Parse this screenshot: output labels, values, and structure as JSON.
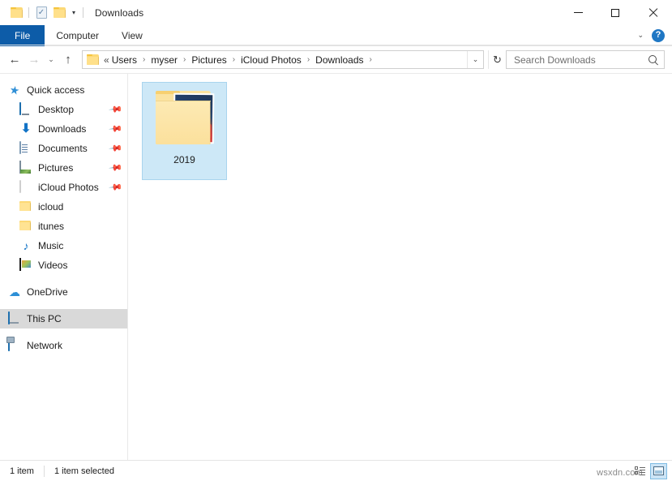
{
  "window": {
    "title": "Downloads",
    "quick_access_toolbar": [
      {
        "name": "folder-icon",
        "label": ""
      },
      {
        "name": "properties-icon",
        "label": ""
      },
      {
        "name": "new-folder-icon",
        "label": ""
      },
      {
        "name": "customize-caret",
        "label": "▾"
      }
    ],
    "controls": {
      "minimize": "Minimize",
      "maximize": "Maximize",
      "close": "Close"
    }
  },
  "ribbon": {
    "tabs": [
      {
        "label": "File",
        "active": true
      },
      {
        "label": "Computer",
        "active": false
      },
      {
        "label": "View",
        "active": false
      }
    ],
    "collapse_caret": "⌄",
    "help_label": "?"
  },
  "addressbar": {
    "back": "←",
    "forward": "→",
    "recent": "⌄",
    "up": "↑",
    "chevron_prefix": "«",
    "crumbs": [
      "Users",
      "myser",
      "Pictures",
      "iCloud Photos",
      "Downloads"
    ],
    "crumb_separator": "›",
    "dropdown_caret": "⌄",
    "refresh": "↻"
  },
  "search": {
    "placeholder": "Search Downloads",
    "value": ""
  },
  "sidebar": {
    "items": [
      {
        "label": "Quick access",
        "icon": "star-icon",
        "pinned": false,
        "root": true,
        "selected": false,
        "gap_before": false
      },
      {
        "label": "Desktop",
        "icon": "desktop-icon",
        "pinned": true,
        "root": false,
        "selected": false,
        "gap_before": false
      },
      {
        "label": "Downloads",
        "icon": "download-icon",
        "pinned": true,
        "root": false,
        "selected": false,
        "gap_before": false
      },
      {
        "label": "Documents",
        "icon": "document-icon",
        "pinned": true,
        "root": false,
        "selected": false,
        "gap_before": false
      },
      {
        "label": "Pictures",
        "icon": "pictures-icon",
        "pinned": true,
        "root": false,
        "selected": false,
        "gap_before": false
      },
      {
        "label": "iCloud Photos",
        "icon": "icloud-photos-icon",
        "pinned": true,
        "root": false,
        "selected": false,
        "gap_before": false
      },
      {
        "label": "icloud",
        "icon": "folder-icon",
        "pinned": false,
        "root": false,
        "selected": false,
        "gap_before": false
      },
      {
        "label": "itunes",
        "icon": "folder-icon",
        "pinned": false,
        "root": false,
        "selected": false,
        "gap_before": false
      },
      {
        "label": "Music",
        "icon": "music-icon",
        "pinned": false,
        "root": false,
        "selected": false,
        "gap_before": false
      },
      {
        "label": "Videos",
        "icon": "video-icon",
        "pinned": false,
        "root": false,
        "selected": false,
        "gap_before": false
      },
      {
        "label": "OneDrive",
        "icon": "onedrive-icon",
        "pinned": false,
        "root": true,
        "selected": false,
        "gap_before": true
      },
      {
        "label": "This PC",
        "icon": "this-pc-icon",
        "pinned": false,
        "root": true,
        "selected": true,
        "gap_before": true
      },
      {
        "label": "Network",
        "icon": "network-icon",
        "pinned": false,
        "root": true,
        "selected": false,
        "gap_before": true
      }
    ],
    "pin_glyph": "📌"
  },
  "content": {
    "items": [
      {
        "label": "2019",
        "type": "folder",
        "selected": true
      }
    ]
  },
  "statusbar": {
    "item_count": "1 item",
    "selection": "1 item selected",
    "views": [
      {
        "name": "details-view-button",
        "active": false
      },
      {
        "name": "large-icons-view-button",
        "active": true
      }
    ]
  },
  "watermark": {
    "text": "wsxdn.com"
  },
  "colors": {
    "accent_blue": "#0d5ca8",
    "selection_blue": "#cde8f7",
    "sidebar_selected": "#d9d9d9",
    "folder_yellow": "#fbe09c",
    "help_blue": "#1f77c4"
  }
}
